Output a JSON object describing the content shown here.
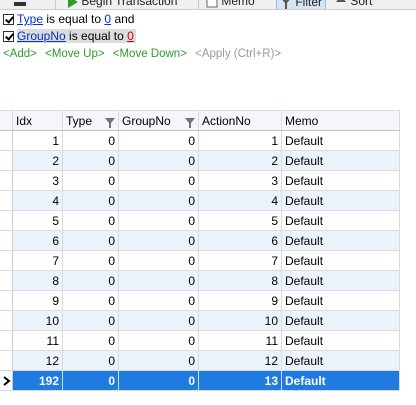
{
  "toolbar": {
    "items": [
      {
        "label": "",
        "icon": "menu-icon"
      },
      {
        "label": "Begin Transaction",
        "icon": "play-icon"
      },
      {
        "label": "Memo",
        "icon": "memo-icon"
      },
      {
        "label": "Filter",
        "icon": "filter-icon"
      },
      {
        "label": "Sort",
        "icon": "sort-icon"
      }
    ]
  },
  "filter": {
    "rows": [
      {
        "field": "Type",
        "op": "is equal to",
        "value": "0",
        "suffix": "and"
      },
      {
        "field": "GroupNo",
        "op": "is equal to",
        "value": "0",
        "suffix": ""
      }
    ],
    "actions": {
      "add": "<Add>",
      "move_up": "<Move Up>",
      "move_down": "<Move Down>",
      "apply": "<Apply (Ctrl+R)>"
    }
  },
  "grid": {
    "columns": [
      "Idx",
      "Type",
      "GroupNo",
      "ActionNo",
      "Memo"
    ],
    "rows": [
      {
        "idx": "1",
        "type": "0",
        "group": "0",
        "action": "1",
        "memo": "Default"
      },
      {
        "idx": "2",
        "type": "0",
        "group": "0",
        "action": "2",
        "memo": "Default"
      },
      {
        "idx": "3",
        "type": "0",
        "group": "0",
        "action": "3",
        "memo": "Default"
      },
      {
        "idx": "4",
        "type": "0",
        "group": "0",
        "action": "4",
        "memo": "Default"
      },
      {
        "idx": "5",
        "type": "0",
        "group": "0",
        "action": "5",
        "memo": "Default"
      },
      {
        "idx": "6",
        "type": "0",
        "group": "0",
        "action": "6",
        "memo": "Default"
      },
      {
        "idx": "7",
        "type": "0",
        "group": "0",
        "action": "7",
        "memo": "Default"
      },
      {
        "idx": "8",
        "type": "0",
        "group": "0",
        "action": "8",
        "memo": "Default"
      },
      {
        "idx": "9",
        "type": "0",
        "group": "0",
        "action": "9",
        "memo": "Default"
      },
      {
        "idx": "10",
        "type": "0",
        "group": "0",
        "action": "10",
        "memo": "Default"
      },
      {
        "idx": "11",
        "type": "0",
        "group": "0",
        "action": "11",
        "memo": "Default"
      },
      {
        "idx": "12",
        "type": "0",
        "group": "0",
        "action": "12",
        "memo": "Default"
      },
      {
        "idx": "192",
        "type": "0",
        "group": "0",
        "action": "13",
        "memo": "Default"
      }
    ],
    "selected_row": 12
  },
  "colors": {
    "selection": "#1f7be0",
    "alt_row": "#edf3fb",
    "action_link": "#2e9b2e",
    "field_link": "#0033cc",
    "value_red": "#cc0000"
  }
}
